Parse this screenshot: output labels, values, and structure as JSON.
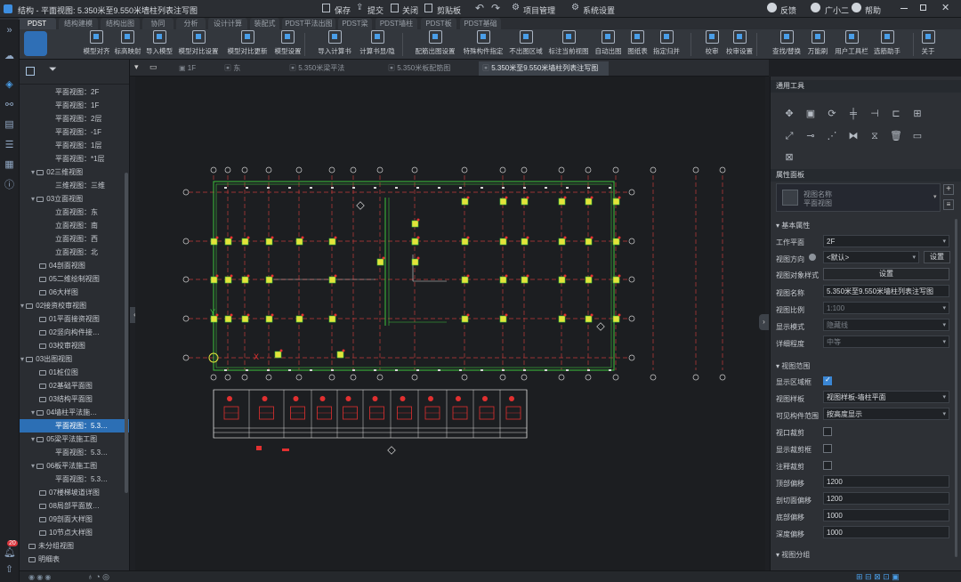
{
  "titlebar": {
    "title": "结构 - 平面视图: 5.350米至9.550米墙柱列表注写图",
    "save": "保存",
    "submit": "提交",
    "close": "关闭",
    "clipboard": "剪贴板",
    "project_manage": "项目管理",
    "system_settings": "系统设置",
    "feedback": "反馈",
    "user": "广小二",
    "help": "帮助"
  },
  "ribbon_tabs": [
    "PDST",
    "结构建模",
    "结构出图",
    "协同",
    "分析",
    "设计计算",
    "装配式",
    "PDST平法出图",
    "PDST梁",
    "PDST墙柱",
    "PDST板",
    "PDST基础"
  ],
  "ribbon_buttons": [
    {
      "label": "模型对齐",
      "icon": "model-align-icon"
    },
    {
      "label": "标高映射",
      "icon": "level-map-icon"
    },
    {
      "label": "导入模型",
      "icon": "import-model-icon"
    },
    {
      "label": "模型对比设置",
      "icon": "compare-settings-icon"
    },
    {
      "label": "模型对比更新",
      "icon": "compare-update-icon"
    },
    {
      "label": "模型设置",
      "icon": "model-settings-icon"
    },
    {
      "label": "导入计算书",
      "icon": "import-calc-icon"
    },
    {
      "label": "计算书显/隐",
      "icon": "calc-toggle-icon"
    },
    {
      "label": "配筋出图设置",
      "icon": "rebar-settings-icon"
    },
    {
      "label": "特殊构件指定",
      "icon": "special-member-icon"
    },
    {
      "label": "不出图区域",
      "icon": "no-draw-area-icon"
    },
    {
      "label": "标注当前视图",
      "icon": "annotate-view-icon"
    },
    {
      "label": "自动出图",
      "icon": "auto-draw-icon"
    },
    {
      "label": "图纸表",
      "icon": "sheet-table-icon"
    },
    {
      "label": "指定归并",
      "icon": "merge-icon"
    },
    {
      "label": "校审",
      "icon": "review-icon"
    },
    {
      "label": "校审设置",
      "icon": "review-settings-icon"
    },
    {
      "label": "查找/替换",
      "icon": "find-replace-icon"
    },
    {
      "label": "万能刷",
      "icon": "brush-icon"
    },
    {
      "label": "用户工具栏",
      "icon": "user-toolbar-icon"
    },
    {
      "label": "选筋助手",
      "icon": "rebar-helper-icon"
    },
    {
      "label": "关于",
      "icon": "about-icon"
    }
  ],
  "doc_tabs": [
    "1F",
    "东",
    "5.350米梁平法",
    "5.350米板配筋图",
    "5.350米至9.550米墙柱列表注写图"
  ],
  "tree": [
    "平面视图：2F",
    "平面视图：1F",
    "平面视图：2层",
    "平面视图：-1F",
    "平面视图：1层",
    "平面视图：*1层",
    "02三维视图",
    "三维视图：三维",
    "03立面视图",
    "立面视图：东",
    "立面视图：南",
    "立面视图：西",
    "立面视图：北",
    "04剖面视图",
    "05二维绘制视图",
    "06大样图",
    "02接资校审视图",
    "01平面接资视图",
    "02竖向构件接…",
    "03校审视图",
    "03出图视图",
    "01桩位图",
    "02基础平面图",
    "03结构平面图",
    "04墙柱平法施…",
    "平面视图：5.3…",
    "05梁平法施工图",
    "平面视图：5.3…",
    "06板平法施工图",
    "平面视图：5.3…",
    "07楼梯坡道详图",
    "08局部平面放…",
    "09剖面大样图",
    "10节点大样图",
    "未分组视图",
    "明细表"
  ],
  "right_panel": {
    "tools_title": "通用工具",
    "tools": [
      "move-icon",
      "copy-icon",
      "rotate-icon",
      "align-icon",
      "offset-icon",
      "mirror-axis-icon",
      "array-icon",
      "scale-icon",
      "split-icon",
      "trim-icon",
      "mirror-icon",
      "lock-icon",
      "delete-icon",
      "measure-icon",
      "pin-icon"
    ],
    "props_title": "属性面板",
    "prop_type_name": "视图名称",
    "prop_type_sub": "平面视图",
    "section_basic": "基本属性",
    "work_plane_label": "工作平面",
    "work_plane": "2F",
    "view_dir_label": "视图方向",
    "view_dir": "<默认>",
    "set_label": "设置",
    "obj_style_label": "视图对象样式",
    "obj_style_btn": "设置",
    "view_name_label": "视图名称",
    "view_name": "5.350米至9.550米墙柱列表注写图",
    "scale_label": "视图比例",
    "scale": "1:100",
    "display_mode_label": "显示模式",
    "display_mode": "隐藏线",
    "detail_label": "详细程度",
    "detail": "中等",
    "section_range": "视图范围",
    "show_region_label": "显示区域框",
    "template_label": "视图样板",
    "template": "视图样板-墙柱平面",
    "visible_label": "可见构件范围",
    "visible": "按高度显示",
    "crop_label": "视口裁剪",
    "show_crop_label": "显示裁剪框",
    "note_crop_label": "注释裁剪",
    "top_offset_label": "顶部偏移",
    "top_offset": "1200",
    "cut_offset_label": "剖切面偏移",
    "cut_offset": "1200",
    "bottom_offset_label": "底部偏移",
    "bottom_offset": "1000",
    "depth_offset_label": "深度偏移",
    "depth_offset": "1000",
    "section_group": "视图分组"
  },
  "left_badge": "20"
}
